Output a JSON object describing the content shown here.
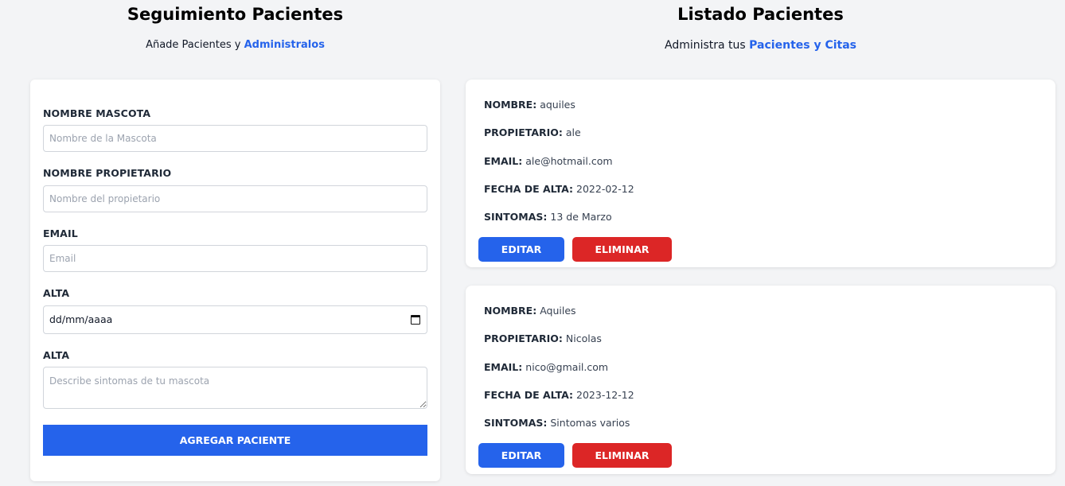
{
  "form_section": {
    "title": "Seguimiento Pacientes",
    "subtitle_plain": "Añade Pacientes y ",
    "subtitle_accent": "Administralos",
    "fields": {
      "pet_name": {
        "label": "NOMBRE MASCOTA",
        "placeholder": "Nombre de la Mascota",
        "value": ""
      },
      "owner_name": {
        "label": "NOMBRE PROPIETARIO",
        "placeholder": "Nombre del propietario",
        "value": ""
      },
      "email": {
        "label": "EMAIL",
        "placeholder": "Email",
        "value": ""
      },
      "date": {
        "label": "ALTA",
        "placeholder": "dd/mm/aaaa"
      },
      "symptoms": {
        "label": "ALTA",
        "placeholder": "Describe sintomas de tu mascota",
        "value": ""
      }
    },
    "submit_label": "AGREGAR PACIENTE",
    "icons": {
      "date": "calendar-icon"
    }
  },
  "list_section": {
    "title": "Listado Pacientes",
    "subtitle_plain": "Administra tus ",
    "subtitle_accent": "Pacientes y Citas",
    "keys": {
      "name": "NOMBRE:",
      "owner": "PROPIETARIO:",
      "email": "EMAIL:",
      "date": "FECHA DE ALTA:",
      "symptoms": "SINTOMAS:"
    },
    "edit_label": "EDITAR",
    "delete_label": "ELIMINAR",
    "patients": [
      {
        "name": "aquiles",
        "owner": "ale",
        "email": "ale@hotmail.com",
        "date": "2022-02-12",
        "symptoms": "13 de Marzo"
      },
      {
        "name": "Aquiles",
        "owner": "Nicolas",
        "email": "nico@gmail.com",
        "date": "2023-12-12",
        "symptoms": "Sintomas varios"
      }
    ]
  },
  "colors": {
    "accent": "#2563eb",
    "danger": "#dc2626",
    "background": "#f3f4f6"
  }
}
